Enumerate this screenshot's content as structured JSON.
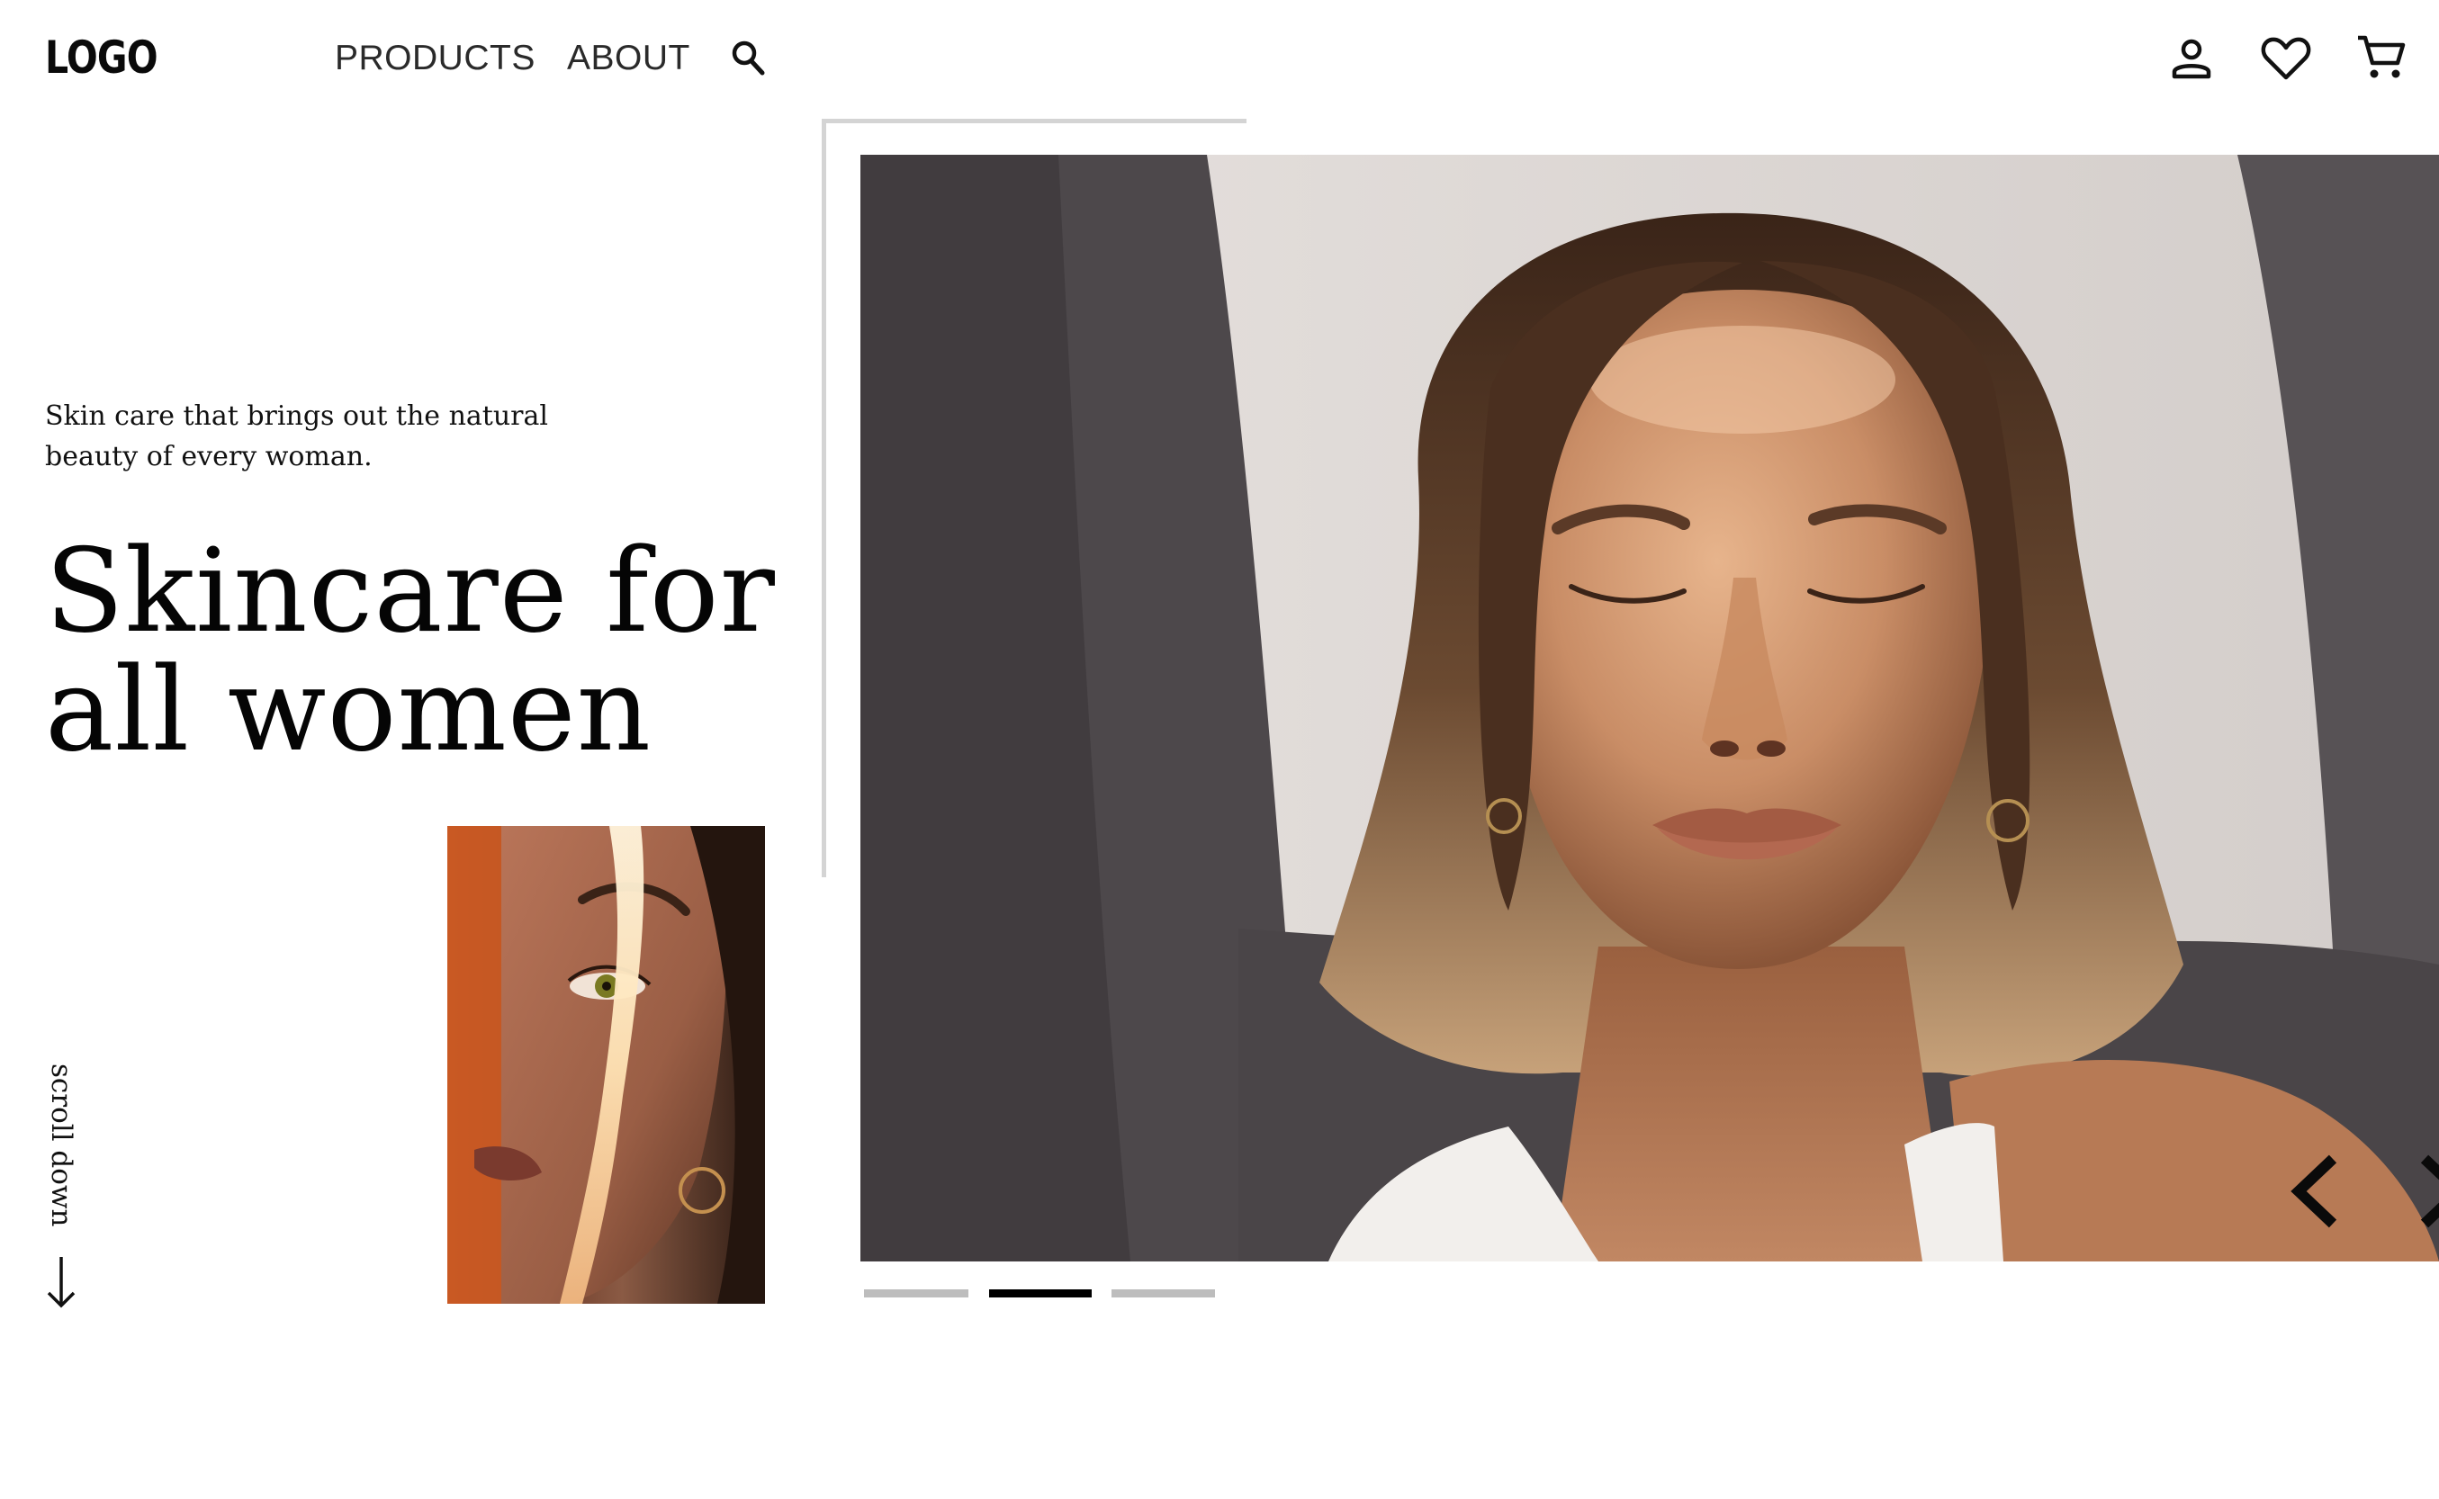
{
  "header": {
    "logo": "LOGO",
    "nav": {
      "products": "PRODUCTS",
      "about": "ABOUT"
    },
    "icons": [
      "search-icon",
      "account-icon",
      "heart-icon",
      "cart-icon"
    ]
  },
  "hero": {
    "tagline": "Skin care that brings out the natural beauty of every woman.",
    "headline_line1": "Skincare for",
    "headline_line2": "all women",
    "scroll_label": "scroll down"
  },
  "carousel": {
    "active_slide": 2,
    "slide_count": 3,
    "colors": {
      "active": "#000000",
      "inactive": "#bdbdbd"
    }
  },
  "colors": {
    "text": "#0a0a0a",
    "frame": "#d4d4d4",
    "background": "#ffffff"
  }
}
